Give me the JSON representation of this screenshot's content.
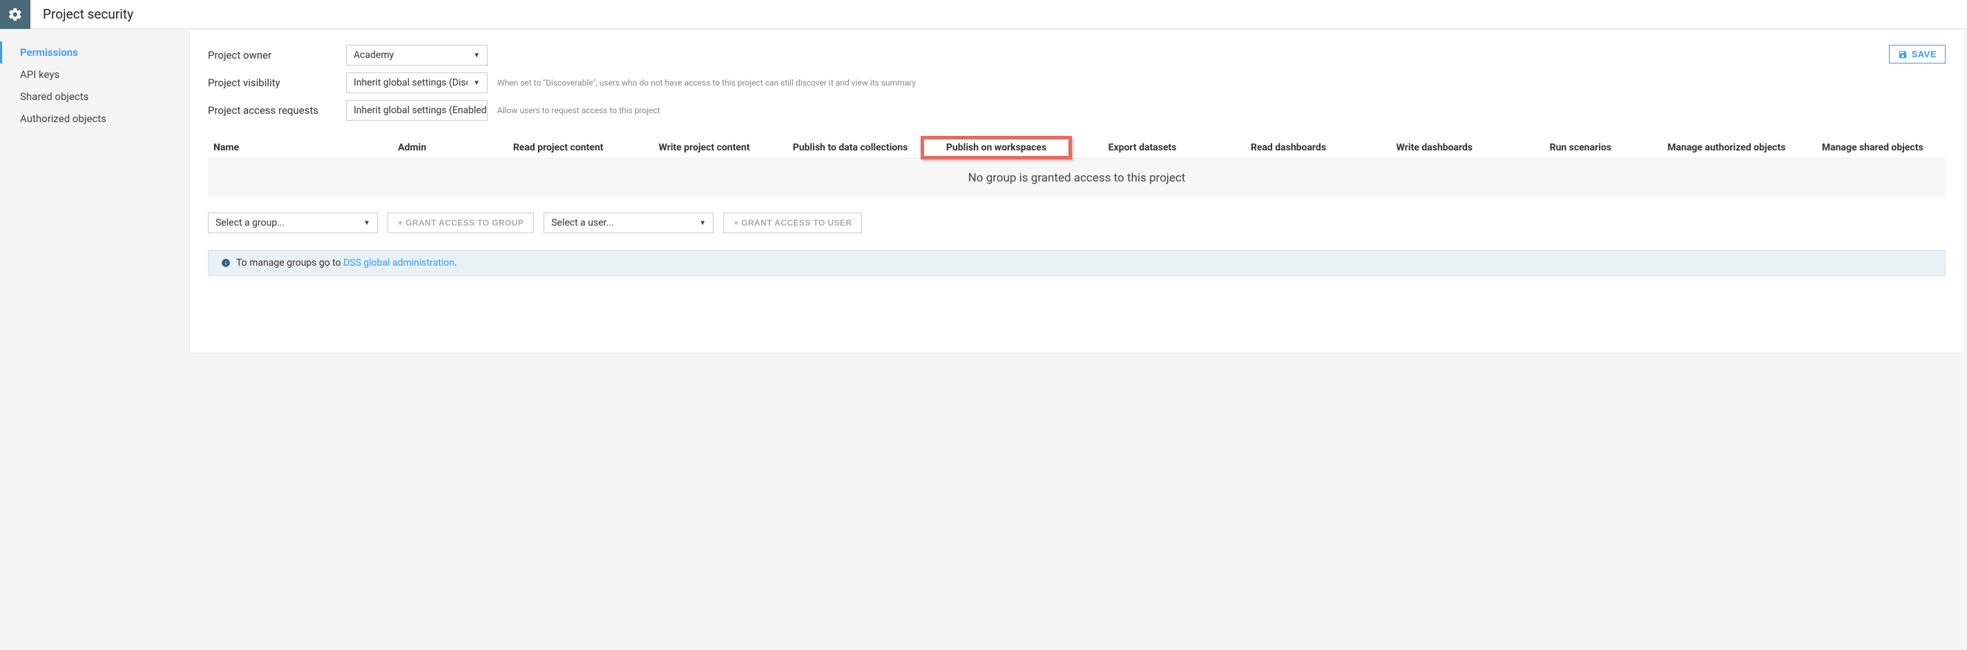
{
  "header": {
    "title": "Project security"
  },
  "sidebar": {
    "items": [
      {
        "label": "Permissions",
        "active": true
      },
      {
        "label": "API keys",
        "active": false
      },
      {
        "label": "Shared objects",
        "active": false
      },
      {
        "label": "Authorized objects",
        "active": false
      }
    ]
  },
  "save_button": "SAVE",
  "settings": {
    "owner": {
      "label": "Project owner",
      "value": "Academy",
      "hint": ""
    },
    "visibility": {
      "label": "Project visibility",
      "value": "Inherit global settings (Discoverat",
      "hint": "When set to \"Discoverable\", users who do not have access to this project can still discover it and view its summary"
    },
    "requests": {
      "label": "Project access requests",
      "value": "Inherit global settings (Enabled)",
      "hint": "Allow users to request access to this project"
    }
  },
  "table": {
    "columns": [
      "Name",
      "Admin",
      "Read project content",
      "Write project content",
      "Publish to data collections",
      "Publish on workspaces",
      "Export datasets",
      "Read dashboards",
      "Write dashboards",
      "Run scenarios",
      "Manage authorized objects",
      "Manage shared objects"
    ],
    "highlighted_column_index": 5,
    "empty_text": "No group is granted access to this project"
  },
  "access": {
    "group_placeholder": "Select a group...",
    "grant_group_label": "+  GRANT ACCESS TO GROUP",
    "user_placeholder": "Select a user...",
    "grant_user_label": "+  GRANT ACCESS TO USER"
  },
  "banner": {
    "text": "To manage groups go to ",
    "link_text": "DSS global administration",
    "suffix": "."
  }
}
